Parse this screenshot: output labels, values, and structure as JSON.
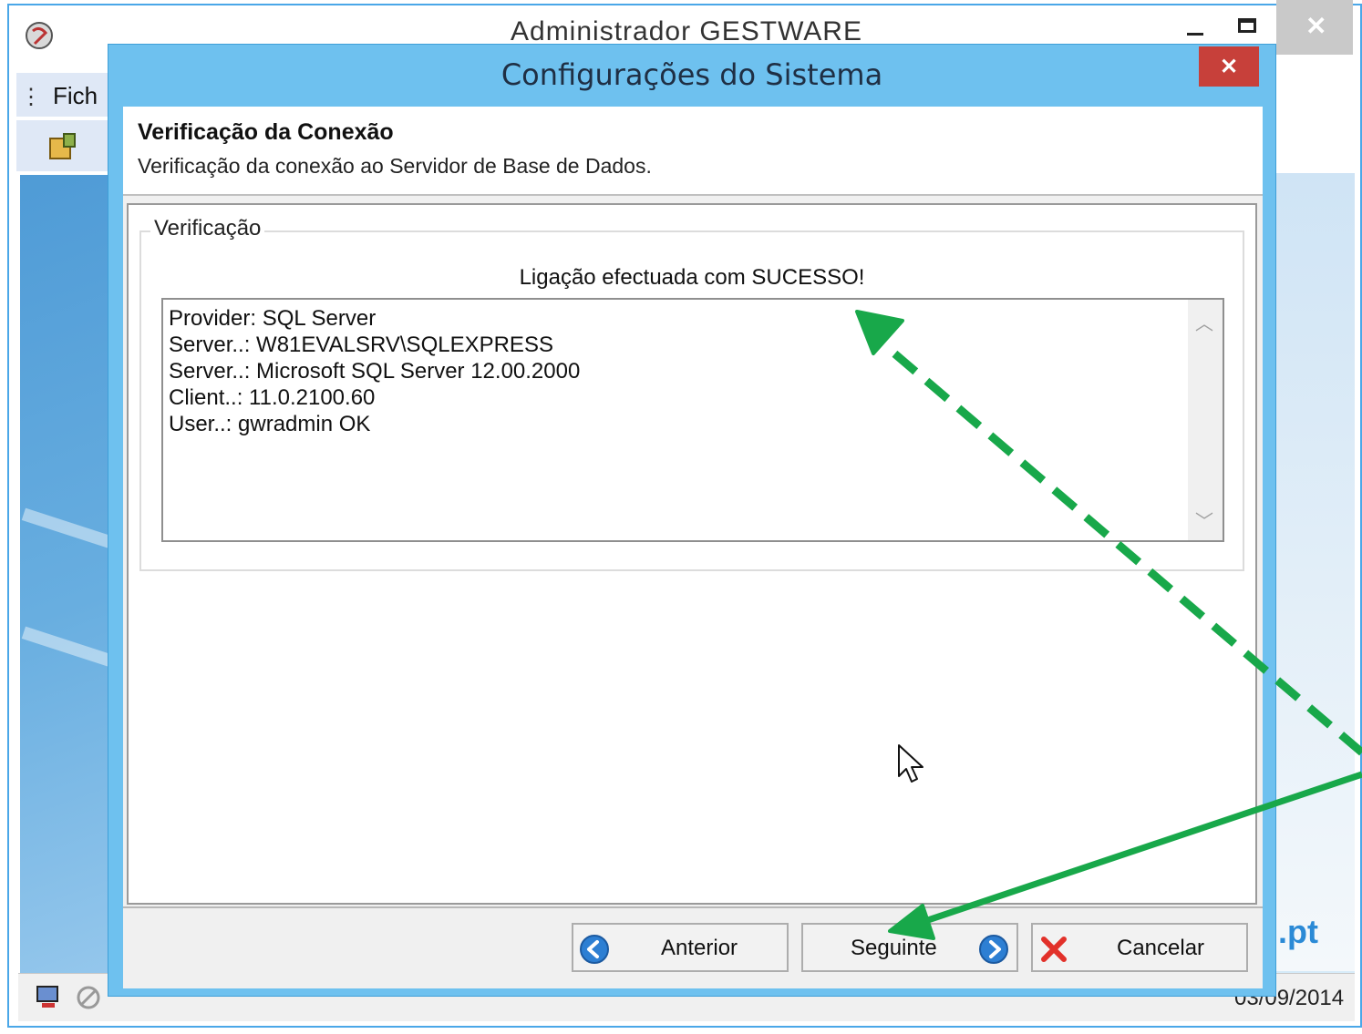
{
  "parent_window": {
    "title": "Administrador GESTWARE",
    "menu_label": "Fich",
    "brand_text": ".pt",
    "status_date": "03/09/2014"
  },
  "dialog": {
    "title": "Configurações do Sistema",
    "close_glyph": "✕",
    "header": {
      "title": "Verificação da Conexão",
      "subtitle": "Verificação da conexão ao Servidor de Base de Dados."
    },
    "group": {
      "legend": "Verificação",
      "status": "Ligação efectuada com SUCESSO!",
      "details": [
        "Provider: SQL Server",
        "Server..: W81EVALSRV\\SQLEXPRESS",
        "Server..: Microsoft SQL Server 12.00.2000",
        "Client..: 11.0.2100.60",
        "User..: gwradmin OK"
      ]
    },
    "buttons": {
      "previous": "Anterior",
      "next": "Seguinte",
      "cancel": "Cancelar"
    }
  },
  "icons": {
    "previous": "arrow-left-circle-icon",
    "next": "arrow-right-circle-icon",
    "cancel": "red-x-icon",
    "close": "close-icon"
  },
  "colors": {
    "dialog_frame": "#6ec1ef",
    "dialog_close": "#c7403a",
    "annotation_arrow": "#18a84a",
    "nav_icon": "#2d7fd3",
    "cancel_icon": "#e2312a"
  }
}
